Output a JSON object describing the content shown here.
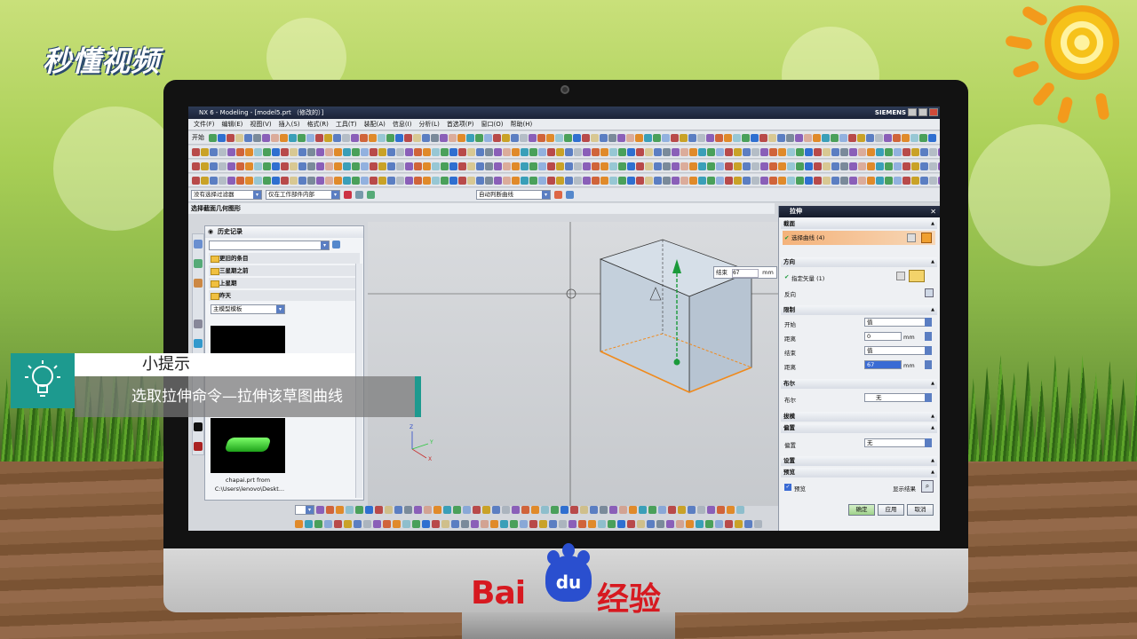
{
  "brand_top": "秒懂视频",
  "brand_bottom": {
    "bai": "Bai",
    "du": "du",
    "jingyan": "经验"
  },
  "window": {
    "title": "NX 6 - Modeling - [model5.prt （修改的）]",
    "vendor": "SIEMENS"
  },
  "menu": [
    "文件(F)",
    "编辑(E)",
    "视图(V)",
    "插入(S)",
    "格式(R)",
    "工具(T)",
    "装配(A)",
    "信息(I)",
    "分析(L)",
    "首选项(P)",
    "窗口(O)",
    "帮助(H)"
  ],
  "toolbar_start": "开始",
  "filter": {
    "selection": "没有选择过滤器",
    "scope": "仅在工作部件内部",
    "curve_rule": "自动判断曲线"
  },
  "status_text": "选择截面几何图形",
  "history": {
    "title": "历史记录",
    "folders": [
      "更旧的条目",
      "三星期之前",
      "上星期",
      "昨天"
    ],
    "template_combo": "主模型模板",
    "file_name": "chapai.prt from",
    "file_path": "C:\\Users\\lenovo\\Deskt..."
  },
  "viewport": {
    "end_label": "结束",
    "end_value": "67",
    "unit": "mm",
    "axis_x": "X",
    "axis_y": "Y",
    "axis_z": "Z"
  },
  "extrude_panel": {
    "title": "拉伸",
    "section": {
      "header": "截面",
      "select_curve": "选择曲线 (4)"
    },
    "direction": {
      "header": "方向",
      "specify_vector": "指定矢量 (1)",
      "reverse": "反向"
    },
    "limits": {
      "header": "限制",
      "start_label": "开始",
      "start_value": "值",
      "distance_label": "距离",
      "start_distance": "0",
      "unit": "mm",
      "end_label": "结束",
      "end_value": "值",
      "end_distance": "67"
    },
    "boolean": {
      "header": "布尔",
      "label": "布尔",
      "value": "无"
    },
    "draft": {
      "header": "拔模"
    },
    "offset": {
      "header": "偏置",
      "label": "偏置",
      "value": "无"
    },
    "settings": {
      "header": "设置"
    },
    "preview": {
      "header": "预览",
      "checkbox": "预览",
      "show_result": "显示结果"
    },
    "buttons": {
      "ok": "确定",
      "apply": "应用",
      "cancel": "取消"
    }
  },
  "tip": {
    "title": "小提示",
    "body": "选取拉伸命令—拉伸该草图曲线"
  }
}
